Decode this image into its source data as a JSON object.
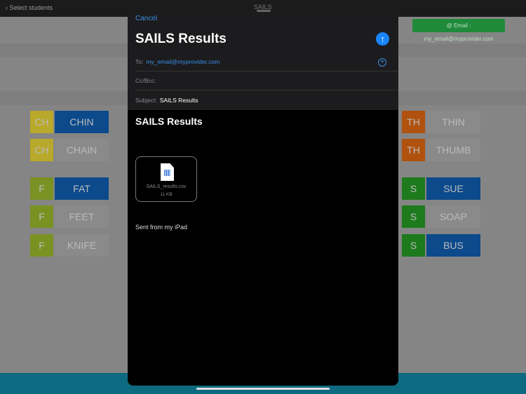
{
  "app": {
    "back_label": "Select students",
    "title": "SAILS",
    "email_button": "@ Email : my_email@myprovider.com"
  },
  "tiles_left": [
    {
      "prefix": "CH",
      "word": "CHIN",
      "prefix_color": "#b8a92a",
      "word_color": "#0c4a8c"
    },
    {
      "prefix": "CH",
      "word": "CHAIN",
      "prefix_color": "#b8a92a",
      "word_color": "#8a8a8a"
    },
    {
      "prefix": "F",
      "word": "FAT",
      "prefix_color": "#7a9222",
      "word_color": "#0c4a8c"
    },
    {
      "prefix": "F",
      "word": "FEET",
      "prefix_color": "#7a9222",
      "word_color": "#8a8a8a"
    },
    {
      "prefix": "F",
      "word": "KNIFE",
      "prefix_color": "#7a9222",
      "word_color": "#8a8a8a"
    }
  ],
  "tiles_right": [
    {
      "prefix": "TH",
      "word": "THIN",
      "prefix_color": "#b0520e",
      "word_color": "#8a8a8a"
    },
    {
      "prefix": "TH",
      "word": "THUMB",
      "prefix_color": "#b0520e",
      "word_color": "#8a8a8a"
    },
    {
      "prefix": "S",
      "word": "SUE",
      "prefix_color": "#1d7a1d",
      "word_color": "#0c4a8c"
    },
    {
      "prefix": "S",
      "word": "SOAP",
      "prefix_color": "#1d7a1d",
      "word_color": "#8a8a8a"
    },
    {
      "prefix": "S",
      "word": "BUS",
      "prefix_color": "#1d7a1d",
      "word_color": "#0c4a8c"
    }
  ],
  "mail": {
    "cancel": "Cancel",
    "title": "SAILS Results",
    "send_icon": "↑",
    "to_label": "To:",
    "to_value": "my_email@myprovider.com",
    "add_icon": "+",
    "cc_label": "Cc/Bcc:",
    "subject_label": "Subject:",
    "subject_value": "SAILS Results",
    "body_title": "SAILS Results",
    "attachment": {
      "name": "SAILS_results.csv",
      "size": "11 KB"
    },
    "signature": "Sent from my iPad"
  }
}
